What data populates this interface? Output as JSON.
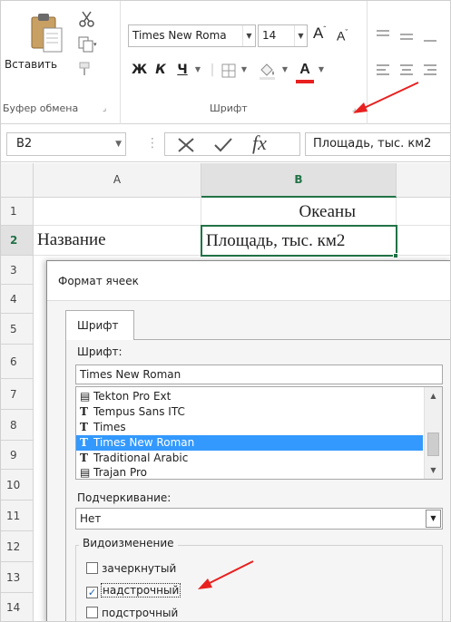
{
  "ribbon": {
    "clipboard": {
      "paste_label": "Вставить",
      "group_label": "Буфер обмена"
    },
    "font": {
      "font_name": "Times New Roma",
      "font_size": "14",
      "bold": "Ж",
      "italic": "К",
      "underline": "Ч",
      "increase_size": "A",
      "decrease_size": "A",
      "font_color_letter": "A",
      "group_label": "Шрифт"
    }
  },
  "formula_bar": {
    "name_box": "B2",
    "fx": "fx",
    "content": "Площадь, тыс. км2"
  },
  "sheet": {
    "columns": [
      "A",
      "B"
    ],
    "rows": [
      "1",
      "2",
      "3",
      "4",
      "5",
      "6",
      "7",
      "8",
      "9",
      "10",
      "11",
      "12",
      "13",
      "14"
    ],
    "b1": "Океаны",
    "a2": "Название",
    "b2": "Площадь, тыс. км2"
  },
  "dialog": {
    "title": "Формат ячеек",
    "tab": "Шрифт",
    "font_label": "Шрифт:",
    "font_value": "Times New Roman",
    "font_list": [
      {
        "label": "Tekton Pro Ext",
        "icon": "printer-font-icon",
        "selected": false
      },
      {
        "label": "Tempus Sans ITC",
        "icon": "truetype-icon",
        "selected": false
      },
      {
        "label": "Times",
        "icon": "truetype-icon",
        "selected": false
      },
      {
        "label": "Times New Roman",
        "icon": "truetype-icon",
        "selected": true
      },
      {
        "label": "Traditional Arabic",
        "icon": "truetype-icon",
        "selected": false
      },
      {
        "label": "Trajan Pro",
        "icon": "printer-font-icon",
        "selected": false
      }
    ],
    "underline_label": "Подчеркивание:",
    "underline_value": "Нет",
    "effects_label": "Видоизменение",
    "strikethrough": {
      "label": "зачеркнутый",
      "checked": false
    },
    "superscript": {
      "label": "надстрочный",
      "checked": true
    },
    "subscript": {
      "label": "подстрочный",
      "checked": false
    }
  },
  "colors": {
    "excel_green": "#217346",
    "selection_blue": "#3399ff",
    "annotation_red": "#e8201f"
  }
}
